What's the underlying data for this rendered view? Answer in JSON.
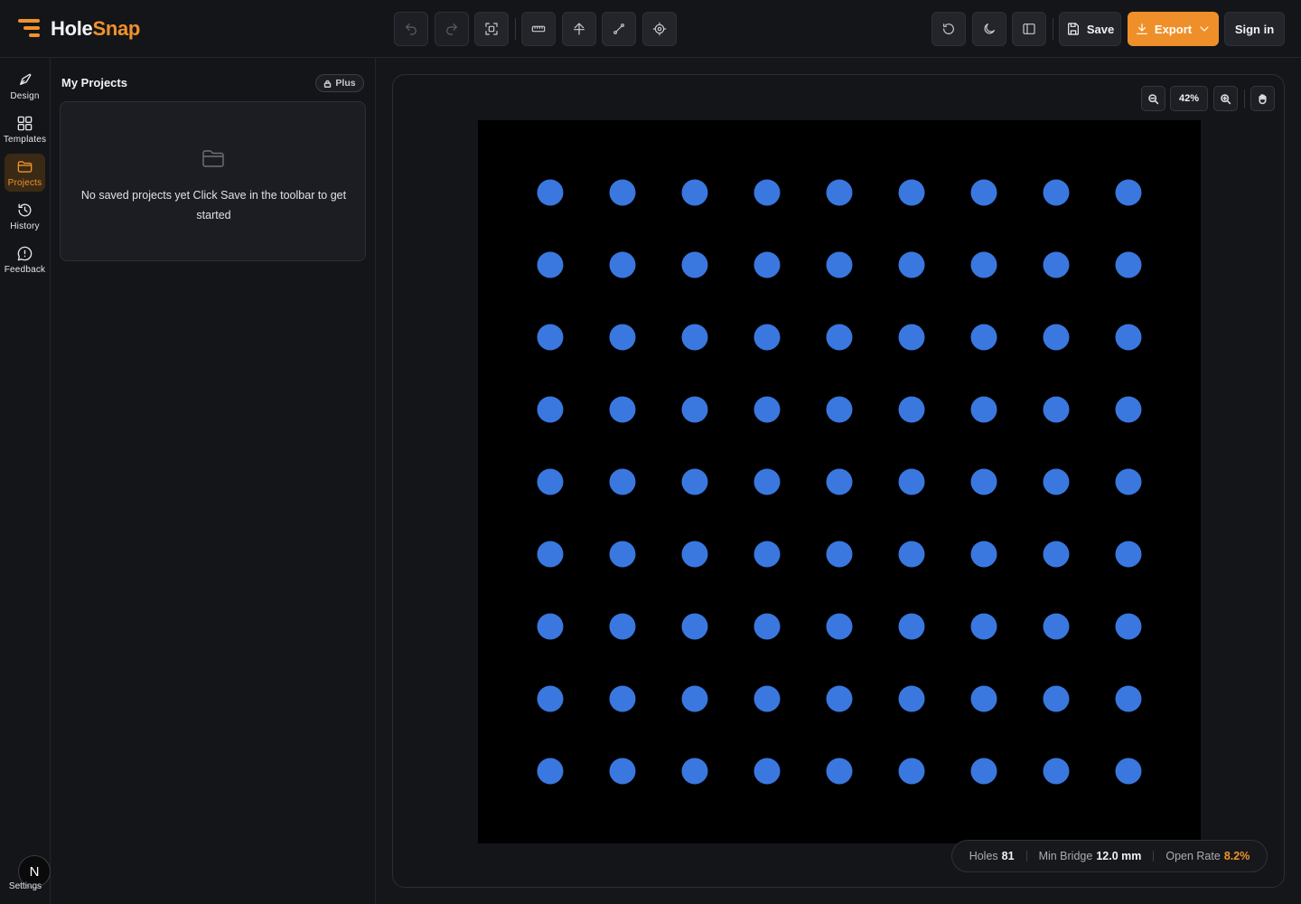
{
  "app": {
    "brand_part1": "Hole",
    "brand_part2": "Snap",
    "accent": "#f0922a"
  },
  "toolbar": {
    "tools": [
      {
        "name": "undo-icon",
        "enabled": false
      },
      {
        "name": "redo-icon",
        "enabled": false
      },
      {
        "name": "fit-to-screen-icon",
        "enabled": true
      },
      {
        "name": "ruler-icon",
        "enabled": true
      },
      {
        "name": "align-icon",
        "enabled": true
      },
      {
        "name": "path-icon",
        "enabled": true
      },
      {
        "name": "crosshair-icon",
        "enabled": true
      }
    ],
    "save_label": "Save",
    "export_label": "Export",
    "signin_label": "Sign in"
  },
  "rail": {
    "items": [
      {
        "label": "Design",
        "icon": "pen-icon",
        "active": false
      },
      {
        "label": "Templates",
        "icon": "grid-icon",
        "active": false
      },
      {
        "label": "Projects",
        "icon": "folder-icon",
        "active": true
      },
      {
        "label": "History",
        "icon": "history-icon",
        "active": false
      },
      {
        "label": "Feedback",
        "icon": "message-icon",
        "active": false
      }
    ],
    "avatar_initial": "N",
    "settings_label": "Settings"
  },
  "projects": {
    "title": "My Projects",
    "badge": "Plus",
    "empty_message": "No saved projects yet Click Save in the toolbar to get started"
  },
  "canvas": {
    "zoom": "42%",
    "board_color": "#000000",
    "hole_color": "#3a78e0",
    "grid_rows": 9,
    "grid_cols": 9
  },
  "stats": {
    "holes_label": "Holes",
    "holes_value": "81",
    "bridge_label": "Min Bridge",
    "bridge_value": "12.0 mm",
    "open_label": "Open Rate",
    "open_value": "8.2%"
  }
}
